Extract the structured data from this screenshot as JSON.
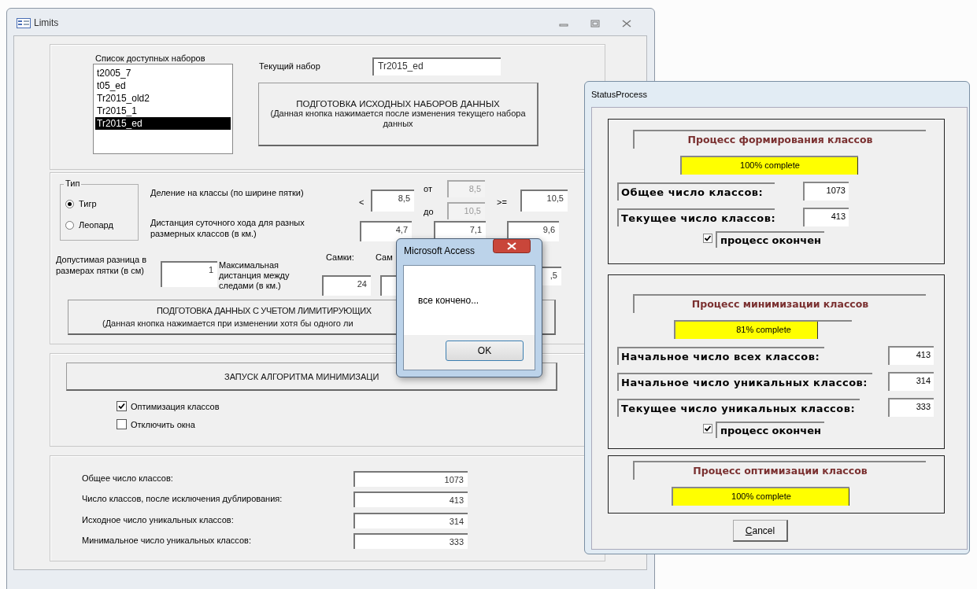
{
  "limits_window": {
    "title": "Limits",
    "datasets": {
      "label": "Список доступных наборов",
      "items": [
        {
          "text": "t2005_7",
          "selected": false
        },
        {
          "text": "t05_ed",
          "selected": false
        },
        {
          "text": "Tr2015_old2",
          "selected": false
        },
        {
          "text": "Tr2015_1",
          "selected": false
        },
        {
          "text": "Tr2015_ed",
          "selected": true
        }
      ]
    },
    "current_set": {
      "label": "Текущий набор",
      "value": "Tr2015_ed"
    },
    "prepare_button": {
      "title": "ПОДГОТОВКА ИСХОДНЫХ НАБОРОВ ДАННЫХ",
      "note": "(Данная кнопка нажимается после изменения текущего набора данных"
    },
    "type_group": {
      "label": "Тип",
      "options": [
        {
          "label": "Тигр",
          "selected": true
        },
        {
          "label": "Леопард",
          "selected": false
        }
      ]
    },
    "class_split": {
      "label": "Деление на классы (по ширине пятки)",
      "lt_sign": "<",
      "lt_value": "8,5",
      "from_label": "от",
      "from_value": "8,5",
      "to_label": "до",
      "to_value": "10,5",
      "ge_sign": ">=",
      "ge_value": "10,5"
    },
    "daily_distance": {
      "label": "Дистанция суточного хода для разных размерных классов (в км.)",
      "values": [
        "4,7",
        "7,1",
        "9,6"
      ]
    },
    "heel_difference": {
      "label": "Допустимая разница в размерах пятки (в см)",
      "value": "1"
    },
    "max_distance": {
      "label": "Максимальная дистанция между следами (в км.)",
      "column_1_label": "Самки:",
      "column_2_label": "Сам",
      "column_1_value": "24",
      "column_3_value": ",5"
    },
    "limits_button": {
      "title": "ПОДГОТОВКА ДАННЫХ С УЧЕТОМ ЛИМИТИРУЮЩИХ",
      "note": "(Данная кнопка нажимается при изменении хотя бы одного ли"
    },
    "run_button": "ЗАПУСК АЛГОРИТМА МИНИМИЗАЦИ",
    "options": [
      {
        "label": "Оптимизация классов",
        "checked": true
      },
      {
        "label": "Отключить окна",
        "checked": false
      }
    ],
    "results": [
      {
        "label": "Общее число классов:",
        "value": "1073"
      },
      {
        "label": "Число классов, после исключения дублирования:",
        "value": "413"
      },
      {
        "label": "Исходное число уникальных классов:",
        "value": "314"
      },
      {
        "label": "Минимальное число уникальных классов:",
        "value": "333"
      }
    ]
  },
  "message_box": {
    "title": "Microsoft Access",
    "message": "все кончено...",
    "button": "OK"
  },
  "status_window": {
    "title": "StatusProcess",
    "stages": [
      {
        "title": "Процесс формирования классов",
        "progress": {
          "level": 1,
          "text": "100% complete"
        },
        "counters": [
          {
            "label": "Общее число классов:",
            "value": "1073"
          },
          {
            "label": "Текущее число классов:",
            "value": "413"
          }
        ],
        "done": {
          "label": "процесс окончен",
          "checked": true
        }
      },
      {
        "title": "Процесс минимизации классов",
        "progress": {
          "level": 0.81,
          "text": "81% complete"
        },
        "counters": [
          {
            "label": "Начальное число всех классов:",
            "value": "413"
          },
          {
            "label": "Начальное число уникальных классов:",
            "value": "314"
          },
          {
            "label": "Текущее число уникальных классов:",
            "value": "333"
          }
        ],
        "done": {
          "label": "процесс окончен",
          "checked": true
        }
      },
      {
        "title": "Процесс оптимизации классов",
        "progress": {
          "level": 1,
          "text": "100% complete"
        }
      }
    ],
    "cancel_button": "Cancel"
  }
}
